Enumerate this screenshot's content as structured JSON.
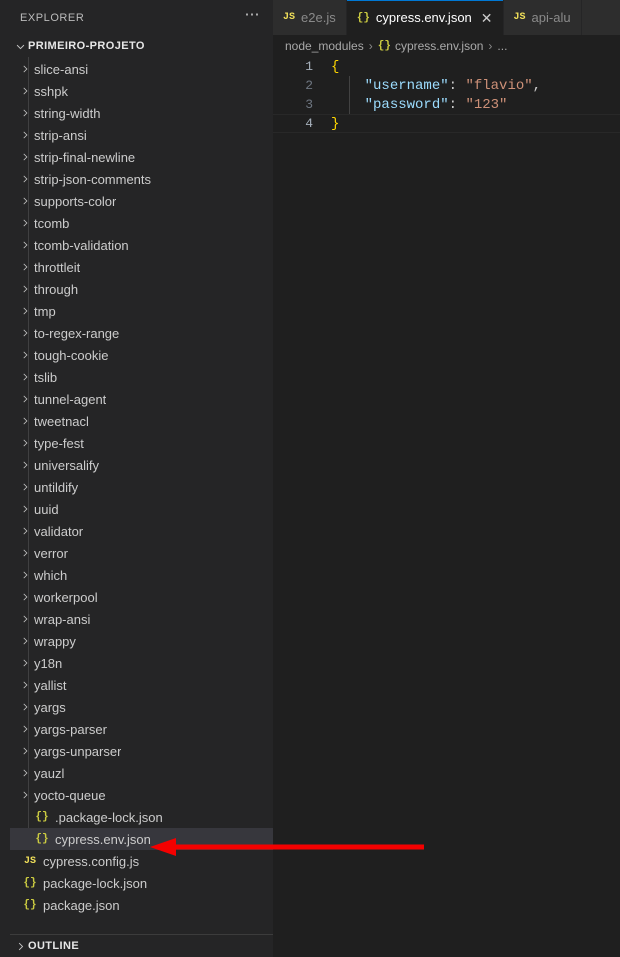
{
  "sidebar": {
    "header": {
      "title": "EXPLORER",
      "more_icon": "ellipsis-icon"
    },
    "project": {
      "name": "PRIMEIRO-PROJETO",
      "expanded": true
    },
    "folders": [
      "slice-ansi",
      "sshpk",
      "string-width",
      "strip-ansi",
      "strip-final-newline",
      "strip-json-comments",
      "supports-color",
      "tcomb",
      "tcomb-validation",
      "throttleit",
      "through",
      "tmp",
      "to-regex-range",
      "tough-cookie",
      "tslib",
      "tunnel-agent",
      "tweetnacl",
      "type-fest",
      "universalify",
      "untildify",
      "uuid",
      "validator",
      "verror",
      "which",
      "workerpool",
      "wrap-ansi",
      "wrappy",
      "y18n",
      "yallist",
      "yargs",
      "yargs-parser",
      "yargs-unparser",
      "yauzl",
      "yocto-queue"
    ],
    "nested_files": [
      {
        "name": ".package-lock.json",
        "icon": "json-icon",
        "selected": false
      },
      {
        "name": "cypress.env.json",
        "icon": "json-icon",
        "selected": true
      }
    ],
    "root_files": [
      {
        "name": "cypress.config.js",
        "icon": "js-icon"
      },
      {
        "name": "package-lock.json",
        "icon": "json-icon"
      },
      {
        "name": "package.json",
        "icon": "json-icon"
      }
    ],
    "outline": {
      "label": "OUTLINE"
    }
  },
  "tabs": [
    {
      "label": "e2e.js",
      "icon": "js-icon",
      "active": false,
      "closable": false
    },
    {
      "label": "cypress.env.json",
      "icon": "json-icon",
      "active": true,
      "closable": true,
      "close_glyph": "✕"
    },
    {
      "label": "api-alu",
      "icon": "js-icon",
      "active": false,
      "closable": false
    }
  ],
  "breadcrumbs": {
    "root": "node_modules",
    "separator": "›",
    "file": "cypress.env.json",
    "file_icon": "json-icon",
    "overflow": "..."
  },
  "editor": {
    "lines": [
      {
        "num": "1",
        "current": false
      },
      {
        "num": "2",
        "current": false
      },
      {
        "num": "3",
        "current": false
      },
      {
        "num": "4",
        "current": true
      }
    ],
    "line1": {
      "brace": "{"
    },
    "line2": {
      "key": "\"username\"",
      "colon": ":",
      "value": "\"flavio\"",
      "comma": ","
    },
    "line3": {
      "key": "\"password\"",
      "colon": ":",
      "value": "\"123\""
    },
    "line4": {
      "brace": "}"
    }
  },
  "annotation": {
    "type": "arrow",
    "color": "#f40000",
    "points_to": "cypress.env.json"
  },
  "colors": {
    "sidebar_bg": "#252526",
    "editor_bg": "#1f1f1f",
    "tabbar_bg": "#2d2d2d",
    "selection_bg": "#37373d",
    "accent": "#0078d4",
    "json_icon": "#cbcb41",
    "js_icon": "#f1e05a",
    "string": "#ce9178",
    "key": "#9cdcfe",
    "brace": "#ffd700"
  }
}
